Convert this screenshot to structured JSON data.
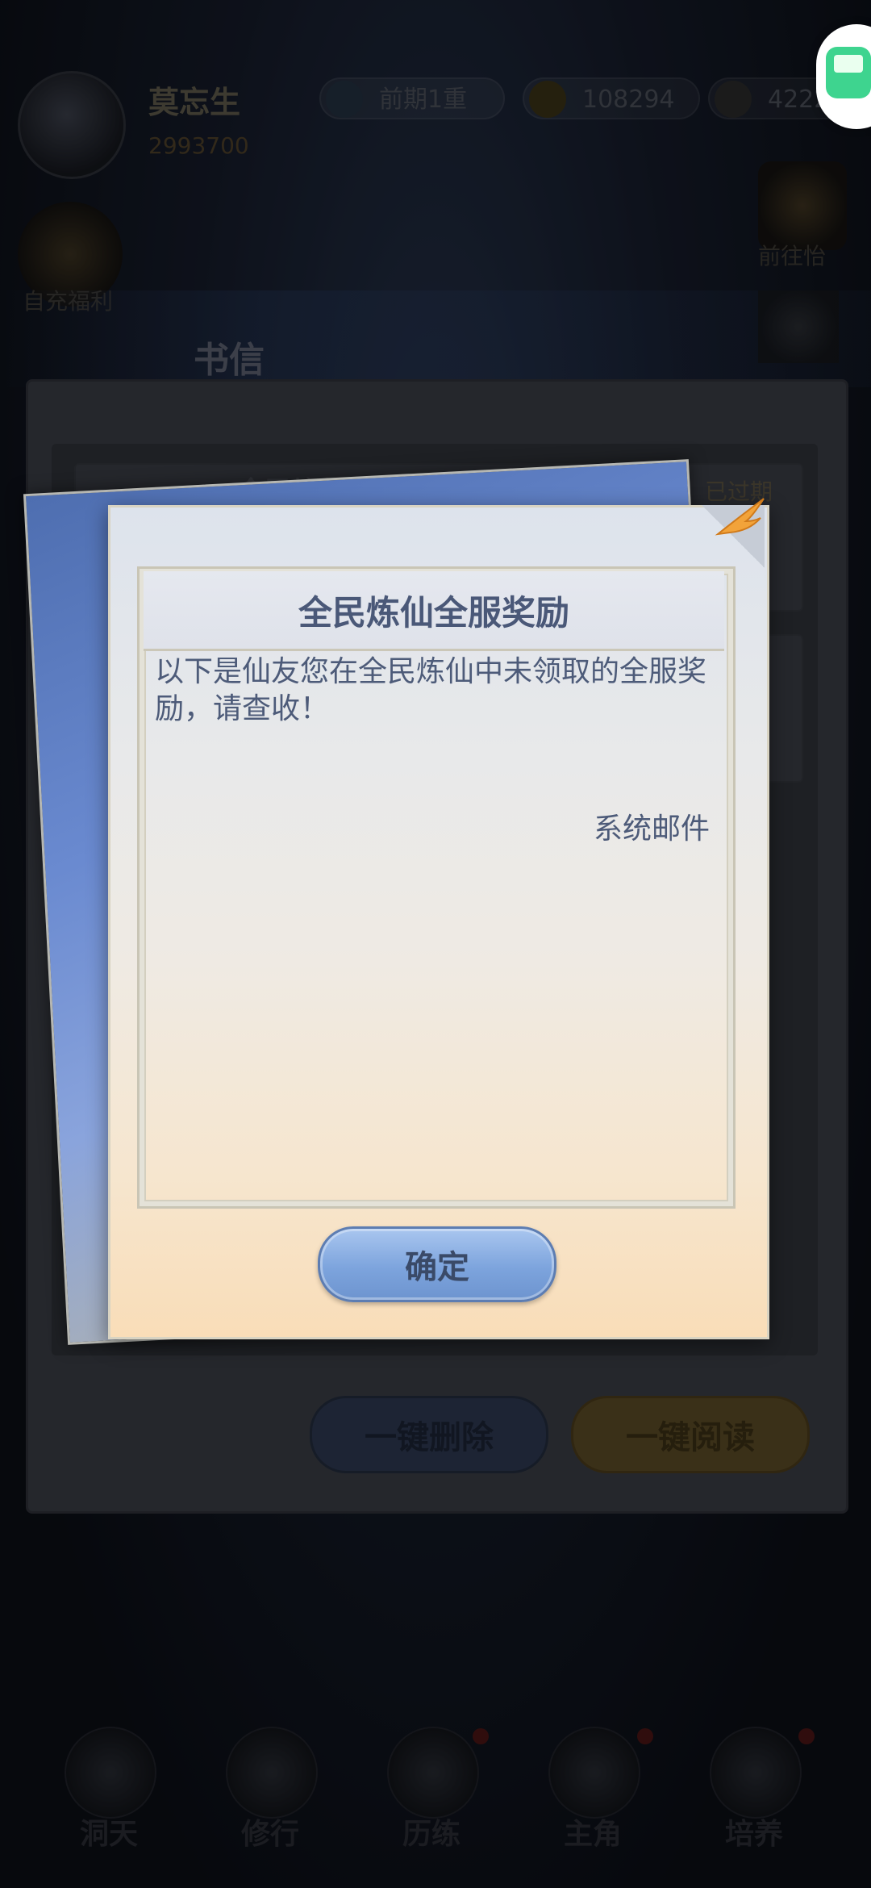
{
  "background": {
    "player": {
      "name": "莫忘生",
      "power": "2993700"
    },
    "resources": [
      {
        "icon": "stage-icon",
        "value": "前期1重"
      },
      {
        "icon": "coin-icon",
        "value": "108294"
      },
      {
        "icon": "spirit-icon",
        "value": "4222"
      }
    ],
    "left_button_label": "自充福利",
    "right_button_label": "前往怡",
    "mail": {
      "title": "书信",
      "items": [
        {
          "title": "全民炼仙全服奖励",
          "tag": "已过期"
        }
      ],
      "delete_all_label": "一键删除",
      "read_all_label": "一键阅读"
    },
    "nav": [
      "洞天",
      "修行",
      "历练",
      "主角",
      "培养"
    ]
  },
  "dialog": {
    "title": "全民炼仙全服奖励",
    "body": "以下是仙友您在全民炼仙中未领取的全服奖励，请查收！",
    "signature": "系统邮件",
    "confirm_label": "确定"
  },
  "colors": {
    "dialog_text": "#4d5b79",
    "button_blue": "#7da4dd",
    "paper_top": "#dde3ec",
    "paper_bottom": "#f9ddb8"
  }
}
